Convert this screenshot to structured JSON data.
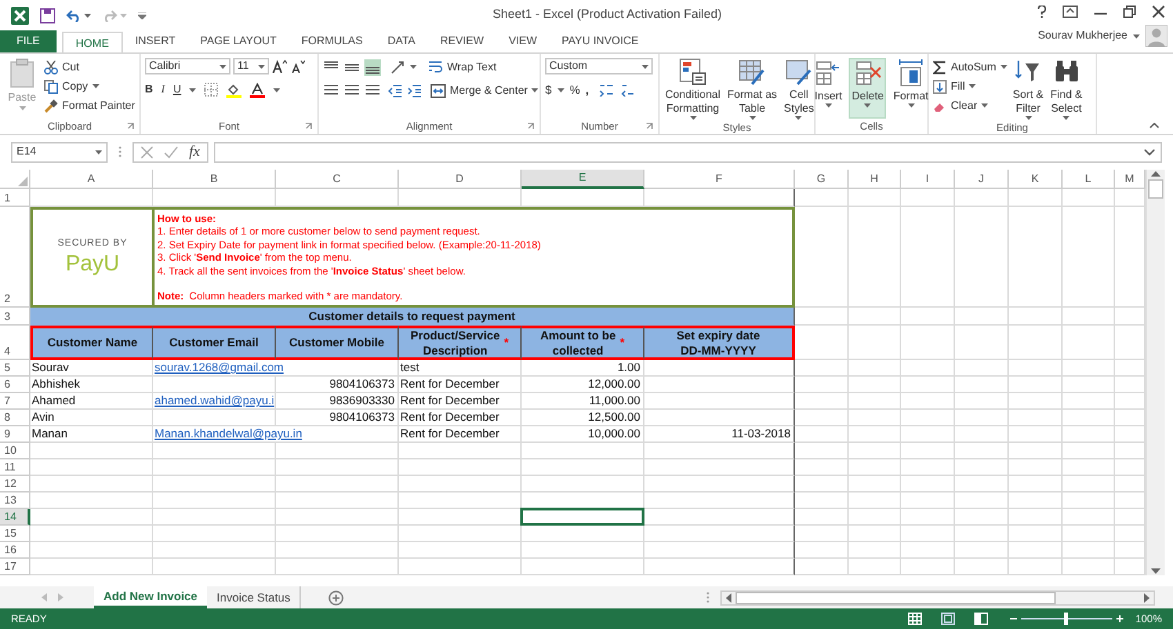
{
  "window": {
    "title": "Sheet1 - Excel (Product Activation Failed)",
    "user": "Sourav Mukherjee"
  },
  "ribbon_tabs": [
    {
      "label": "FILE",
      "kind": "file",
      "selected": false
    },
    {
      "label": "HOME",
      "kind": "tab",
      "selected": true
    },
    {
      "label": "INSERT",
      "kind": "tab",
      "selected": false
    },
    {
      "label": "PAGE LAYOUT",
      "kind": "tab",
      "selected": false
    },
    {
      "label": "FORMULAS",
      "kind": "tab",
      "selected": false
    },
    {
      "label": "DATA",
      "kind": "tab",
      "selected": false
    },
    {
      "label": "REVIEW",
      "kind": "tab",
      "selected": false
    },
    {
      "label": "VIEW",
      "kind": "tab",
      "selected": false
    },
    {
      "label": "PAYU INVOICE",
      "kind": "tab",
      "selected": false
    }
  ],
  "ribbon": {
    "clipboard": {
      "title": "Clipboard",
      "paste": "Paste",
      "cut": "Cut",
      "copy": "Copy",
      "format_painter": "Format Painter"
    },
    "font": {
      "title": "Font",
      "family": "Calibri",
      "size": "11",
      "bold": "B",
      "italic": "I",
      "underline": "U"
    },
    "alignment": {
      "title": "Alignment",
      "wrap_text": "Wrap Text",
      "merge_center": "Merge & Center"
    },
    "number": {
      "title": "Number",
      "format": "Custom",
      "currency": "$",
      "percent": "%",
      "comma": ","
    },
    "styles": {
      "title": "Styles",
      "buttons": [
        {
          "lines": [
            "Conditional",
            "Formatting"
          ]
        },
        {
          "lines": [
            "Format as",
            "Table"
          ]
        },
        {
          "lines": [
            "Cell",
            "Styles"
          ]
        }
      ]
    },
    "cells": {
      "title": "Cells",
      "buttons": [
        {
          "label": "Insert",
          "selected": false
        },
        {
          "label": "Delete",
          "selected": true
        },
        {
          "label": "Format",
          "selected": false
        }
      ]
    },
    "editing": {
      "title": "Editing",
      "autosum": "AutoSum",
      "fill": "Fill",
      "clear": "Clear",
      "sort_filter": [
        "Sort &",
        "Filter"
      ],
      "find_select": [
        "Find &",
        "Select"
      ]
    }
  },
  "formula_bar": {
    "name_box": "E14",
    "function_label": "fx"
  },
  "sheet": {
    "columns": [
      {
        "label": "A",
        "selected": false
      },
      {
        "label": "B",
        "selected": false
      },
      {
        "label": "C",
        "selected": false
      },
      {
        "label": "D",
        "selected": false
      },
      {
        "label": "E",
        "selected": true
      },
      {
        "label": "F",
        "selected": false
      },
      {
        "label": "G",
        "selected": false
      },
      {
        "label": "H",
        "selected": false
      },
      {
        "label": "I",
        "selected": false
      },
      {
        "label": "J",
        "selected": false
      },
      {
        "label": "K",
        "selected": false
      },
      {
        "label": "L",
        "selected": false
      },
      {
        "label": "M",
        "selected": false
      }
    ],
    "rows": [
      {
        "label": "1",
        "selected": false
      },
      {
        "label": "2",
        "selected": false
      },
      {
        "label": "3",
        "selected": false
      },
      {
        "label": "4",
        "selected": false
      },
      {
        "label": "5",
        "selected": false
      },
      {
        "label": "6",
        "selected": false
      },
      {
        "label": "7",
        "selected": false
      },
      {
        "label": "8",
        "selected": false
      },
      {
        "label": "9",
        "selected": false
      },
      {
        "label": "10",
        "selected": false
      },
      {
        "label": "11",
        "selected": false
      },
      {
        "label": "12",
        "selected": false
      },
      {
        "label": "13",
        "selected": false
      },
      {
        "label": "14",
        "selected": true
      },
      {
        "label": "15",
        "selected": false
      },
      {
        "label": "16",
        "selected": false
      },
      {
        "label": "17",
        "selected": false
      }
    ],
    "logo": {
      "caption": "SECURED BY",
      "brand": "PayU"
    },
    "instructions": {
      "heading": "How to use:",
      "steps": [
        "1. Enter details of 1 or more customer below to send payment request.",
        "2. Set Expiry Date for payment link in format specified below. (Example:20-11-2018)",
        "3. Click '**Send Invoice**' from the top menu.",
        "4. Track all the sent invoices from the '**Invoice Status**' sheet below."
      ],
      "note_label": "Note:",
      "note": "Column headers marked with * are mandatory."
    },
    "table_title": "Customer details to request payment",
    "headers": [
      {
        "lines": [
          "Customer Name"
        ]
      },
      {
        "lines": [
          "Customer Email"
        ]
      },
      {
        "lines": [
          "Customer Mobile"
        ]
      },
      {
        "lines": [
          "Product/Service",
          "Description"
        ],
        "mark": "*"
      },
      {
        "lines": [
          "Amount to be",
          "collected"
        ],
        "mark": "*"
      },
      {
        "lines": [
          "Set expiry date",
          "DD-MM-YYYY"
        ]
      }
    ],
    "records": [
      {
        "name": "Sourav",
        "email": "sourav.1268@gmail.com",
        "description": "test",
        "amount": "1.00"
      },
      {
        "name": "Abhishek",
        "mobile": "9804106373",
        "description": "Rent for December",
        "amount": "12,000.00"
      },
      {
        "name": "Ahamed",
        "email": "ahamed.wahid@payu.i",
        "mobile": "9836903330",
        "description": "Rent for December",
        "amount": "11,000.00"
      },
      {
        "name": "Avin",
        "mobile": "9804106373",
        "description": "Rent for December",
        "amount": "12,500.00"
      },
      {
        "name": "Manan",
        "email": "Manan.khandelwal@payu.in",
        "description": "Rent for December",
        "amount": "10,000.00",
        "expiry": "11-03-2018"
      }
    ]
  },
  "sheet_tabs": [
    {
      "label": "Add New Invoice",
      "selected": true
    },
    {
      "label": "Invoice Status",
      "selected": false
    }
  ],
  "status_bar": {
    "mode": "READY",
    "zoom": "100%",
    "zoom_slider": {
      "level": 0.5
    }
  }
}
